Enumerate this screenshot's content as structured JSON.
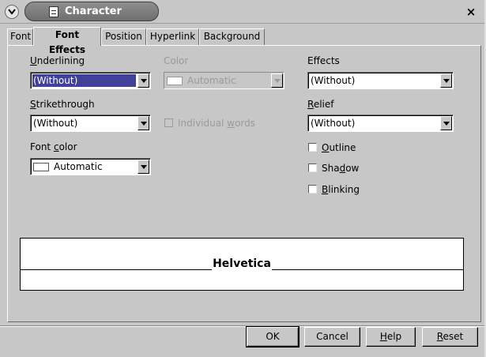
{
  "window": {
    "title": "Character",
    "close_glyph": "×"
  },
  "tabs": [
    "Font",
    "Font Effects",
    "Position",
    "Hyperlink",
    "Background"
  ],
  "active_tab": "Font Effects",
  "underlining": {
    "label_u": "U",
    "label_rest": "nderlining",
    "value": "(Without)"
  },
  "color": {
    "label": "Color",
    "value": "Automatic",
    "enabled": false
  },
  "strikethrough": {
    "label_u": "S",
    "label_rest": "trikethrough",
    "value": "(Without)"
  },
  "individual_words": {
    "label_pre": "Individual ",
    "label_u": "w",
    "label_rest": "ords",
    "enabled": false,
    "checked": false
  },
  "font_color": {
    "label_pre": "Font ",
    "label_u": "c",
    "label_rest": "olor",
    "value": "Automatic"
  },
  "effects": {
    "label": "Effects",
    "value": "(Without)"
  },
  "relief": {
    "label_u": "R",
    "label_rest": "elief",
    "value": "(Without)"
  },
  "outline": {
    "label_u": "O",
    "label_rest": "utline",
    "checked": false
  },
  "shadow": {
    "label_pre": "Sha",
    "label_u": "d",
    "label_rest": "ow",
    "checked": false
  },
  "blinking": {
    "label_u": "B",
    "label_rest": "linking",
    "checked": false
  },
  "preview": {
    "text": "Helvetica"
  },
  "buttons": {
    "ok": "OK",
    "cancel": "Cancel",
    "help_u": "H",
    "help_rest": "elp",
    "reset_u": "R",
    "reset_rest": "eset"
  },
  "colors": {
    "selection": "#41419a",
    "dialog_bg": "#c7c7c7"
  }
}
